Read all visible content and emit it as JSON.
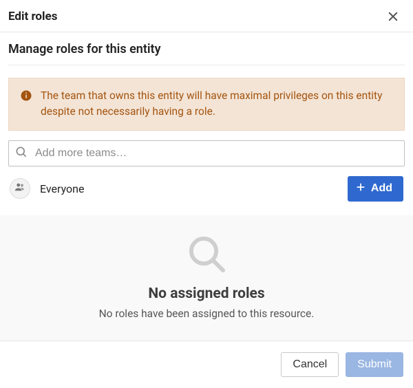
{
  "header": {
    "title": "Edit roles"
  },
  "section": {
    "title": "Manage roles for this entity"
  },
  "info": {
    "message": "The team that owns this entity will have maximal privileges on this entity despite not necessarily having a role."
  },
  "search": {
    "placeholder": "Add more teams…",
    "value": ""
  },
  "team": {
    "name": "Everyone",
    "add_label": "Add"
  },
  "empty": {
    "title": "No assigned roles",
    "subtitle": "No roles have been assigned to this resource."
  },
  "footer": {
    "cancel_label": "Cancel",
    "submit_label": "Submit"
  }
}
